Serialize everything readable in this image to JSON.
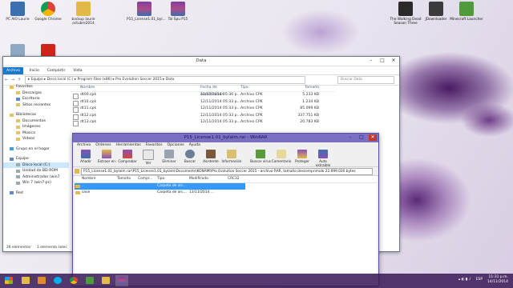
{
  "desktop": {
    "icons": [
      {
        "label": "PC AIO Laurie"
      },
      {
        "label": "Google Chrome"
      },
      {
        "label": "backup laurie octubre2014"
      },
      {
        "label": "P15_License1.01_byl..."
      },
      {
        "label": "Tal Spu P15"
      },
      {
        "label": "Papelera de reciclaje"
      },
      {
        "label": "Adobe Reader"
      },
      {
        "label": "The Walking Dead Season Three"
      },
      {
        "label": "JDownloader"
      },
      {
        "label": "Minecraft Launcher"
      }
    ]
  },
  "explorer": {
    "title": "Data",
    "ribbon": {
      "file": "Archivo",
      "home": "Inicio",
      "share": "Compartir",
      "view": "Vista"
    },
    "path": "▸ Equipo ▸ Disco local (C:) ▸ Program Files (x86) ▸ Pro Evolution Soccer 2015 ▸ Data",
    "search_placeholder": "Buscar Data",
    "nav": {
      "favorites": "Favoritos",
      "downloads": "Descargas",
      "desktop": "Escritorio",
      "recent": "Sitios recientes",
      "libraries": "Bibliotecas",
      "documents": "Documentos",
      "images": "Imágenes",
      "music": "Música",
      "videos": "Vídeos",
      "homegroup": "Grupo en el hogar",
      "computer": "Equipo",
      "local_disk": "Disco local (C:)",
      "bd_rom": "Unidad de BD-ROM",
      "admin": "Administrador (win7",
      "win7": "Win 7 (win7-pc)",
      "network": "Red"
    },
    "columns": {
      "name": "Nombre",
      "date": "Fecha de modificación",
      "type": "Tipo",
      "size": "Tamaño"
    },
    "files": [
      {
        "name": "dt00.cpk",
        "date": "12/11/2014 05:36 p...",
        "type": "Archivo CPK",
        "size": "5.233 KB"
      },
      {
        "name": "dt10.cpk",
        "date": "12/11/2014 05:33 p...",
        "type": "Archivo CPK",
        "size": "1.234 KB"
      },
      {
        "name": "dt11.cpk",
        "date": "12/11/2014 05:33 p...",
        "type": "Archivo CPK",
        "size": "85.099 KB"
      },
      {
        "name": "dt12.cpk",
        "date": "12/11/2014 05:33 p...",
        "type": "Archivo CPK",
        "size": "337.751 KB"
      },
      {
        "name": "dt13.cpk",
        "date": "12/11/2014 05:33 p...",
        "type": "Archivo CPK",
        "size": "20.783 KB"
      }
    ],
    "status": {
      "count": "26 elementos",
      "selected": "1 elemento selec"
    }
  },
  "winrar": {
    "title": "P15_License1.01_bylaim.rar - WinRAR",
    "menu": [
      "Archivo",
      "Órdenes",
      "Herramientas",
      "Favoritos",
      "Opciones",
      "Ayuda"
    ],
    "tools": [
      {
        "label": "Añadir",
        "icon": "add-icon"
      },
      {
        "label": "Extraer en",
        "icon": "extract-icon"
      },
      {
        "label": "Comprobar",
        "icon": "test-icon"
      },
      {
        "label": "Ver",
        "icon": "view-icon"
      },
      {
        "label": "Eliminar",
        "icon": "delete-icon"
      },
      {
        "label": "Buscar",
        "icon": "find-icon"
      },
      {
        "label": "Asistente",
        "icon": "wizard-icon"
      },
      {
        "label": "Información",
        "icon": "info-icon"
      },
      {
        "label": "Buscar virus",
        "icon": "virus-icon"
      },
      {
        "label": "Comentario",
        "icon": "comment-icon"
      },
      {
        "label": "Proteger",
        "icon": "protect-icon"
      },
      {
        "label": "Auto extraíble",
        "icon": "sfx-icon"
      }
    ],
    "path": "P15_License1.01_bylaim.rar\\P15_License1.01_bylaim\\Documents\\KONAMI\\Pro Evolution Soccer 2015 - archivo RAR, tamaño descomprimido 22.699.030 bytes",
    "columns": {
      "name": "Nombre",
      "size": "Tamaño",
      "packed": "Compr...",
      "type": "Tipo",
      "modified": "Modificado",
      "crc": "CRC32"
    },
    "rows": [
      {
        "name": "..",
        "size": "",
        "packed": "",
        "type": "Carpeta de arc...",
        "modified": "",
        "crc": ""
      },
      {
        "name": "save",
        "size": "",
        "packed": "",
        "type": "Carpeta de arc...",
        "modified": "13/11/2014 ...",
        "crc": ""
      }
    ]
  },
  "taskbar": {
    "lang": "ESP",
    "time": "11:31 p.m.",
    "date": "14/11/2014"
  }
}
